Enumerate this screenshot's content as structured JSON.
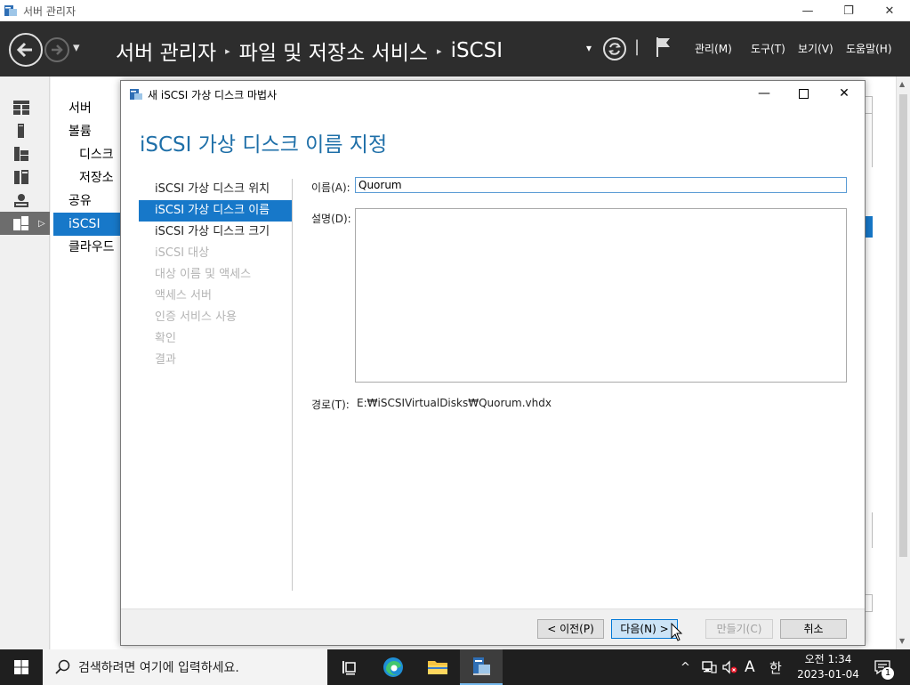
{
  "window": {
    "title": "서버 관리자",
    "minimize": "—",
    "restore": "❐",
    "close": "✕"
  },
  "header": {
    "breadcrumb": [
      "서버 관리자",
      "파일 및 저장소 서비스",
      "iSCSI"
    ],
    "separator": "▸",
    "dropdown_caret": "▾",
    "divider": "|",
    "menus": [
      "관리(M)",
      "도구(T)",
      "보기(V)",
      "도움말(H)"
    ]
  },
  "rail": {
    "icons": [
      "dashboard-icon",
      "server-icon",
      "servers-icon",
      "file-storage-icon",
      "roles-icon",
      "iscsi-icon"
    ]
  },
  "subnav": {
    "items": [
      "서버",
      "볼륨",
      "디스크",
      "저장소",
      "공유",
      "iSCSI",
      "클라우드"
    ]
  },
  "dialog": {
    "title": "새 iSCSI 가상 디스크 마법사",
    "heading": "iSCSI 가상 디스크 이름 지정",
    "steps": [
      "iSCSI 가상 디스크 위치",
      "iSCSI 가상 디스크 이름",
      "iSCSI 가상 디스크 크기",
      "iSCSI 대상",
      "대상 이름 및 액세스",
      "액세스 서버",
      "인증 서비스 사용",
      "확인",
      "결과"
    ],
    "name_label": "이름(A):",
    "name_value": "Quorum",
    "desc_label": "설명(D):",
    "desc_value": "",
    "path_label": "경로(T):",
    "path_value": "E:₩iSCSIVirtualDisks₩Quorum.vhdx",
    "buttons": {
      "prev": "< 이전(P)",
      "next": "다음(N) >",
      "create": "만들기(C)",
      "cancel": "취소"
    }
  },
  "taskbar": {
    "search_placeholder": "검색하려면 여기에 입력하세요.",
    "ime_mode": "A",
    "ime_lang": "한",
    "time": "오전 1:34",
    "date": "2023-01-04",
    "notification_count": "1",
    "tray_chevron": "^"
  }
}
